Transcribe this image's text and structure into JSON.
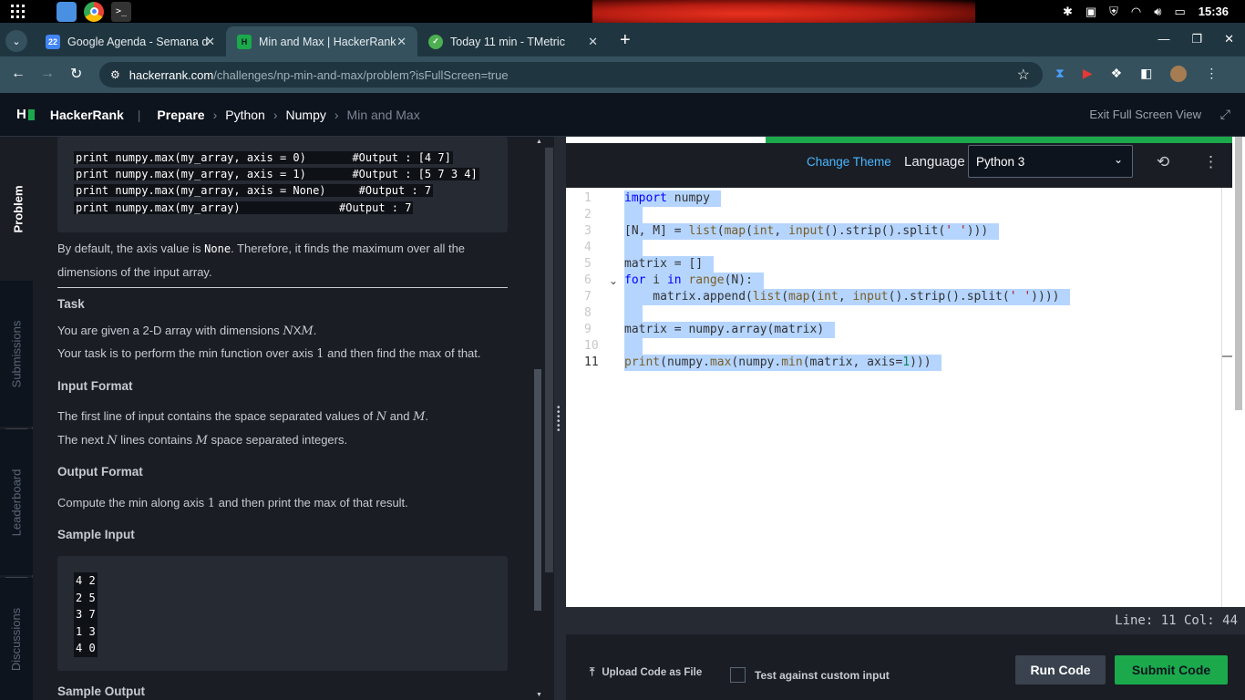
{
  "os": {
    "time": "15:36"
  },
  "browser": {
    "tabs": [
      {
        "title": "Google Agenda - Semana de",
        "icon": "calendar-icon",
        "color": "#4285f4"
      },
      {
        "title": "Min and Max | HackerRank",
        "icon": "hackerrank-icon",
        "color": "#1ba94c"
      },
      {
        "title": "Today 11 min - TMetric",
        "icon": "tmetric-icon",
        "color": "#4caf50"
      }
    ],
    "url_host": "hackerrank.com",
    "url_path": "/challenges/np-min-and-max/problem?isFullScreen=true"
  },
  "header": {
    "logo_text": "HackerRank",
    "breadcrumb": [
      "Prepare",
      "Python",
      "Numpy",
      "Min and Max"
    ],
    "exit_fullscreen": "Exit Full Screen View"
  },
  "sidebar": {
    "tabs": [
      "Problem",
      "Submissions",
      "Leaderboard",
      "Discussions"
    ]
  },
  "problem": {
    "code_lines": [
      {
        "code": "print numpy.max(my_array, axis = 0)",
        "comment": "#Output : [4 7]"
      },
      {
        "code": "print numpy.max(my_array, axis = 1)",
        "comment": "#Output : [5 7 3 4]"
      },
      {
        "code": "print numpy.max(my_array, axis = None)",
        "comment": "#Output : 7"
      },
      {
        "code": "print numpy.max(my_array)",
        "comment": "#Output : 7"
      }
    ],
    "default_pre": "By default, the axis value is ",
    "default_code": "None",
    "default_post": ". Therefore, it finds the maximum over all the dimensions of the input array.",
    "task_heading": "Task",
    "task_line1_pre": "You are given a 2-D array with dimensions ",
    "task_dims": "N",
    "task_x": "X",
    "task_dims2": "M",
    "task_line1_post": ".",
    "task_line2_pre": "Your task is to perform the min function over axis ",
    "task_axis": "1",
    "task_line2_post": " and then find the max of that.",
    "input_heading": "Input Format",
    "input_line1_pre": "The first line of input contains the space separated values of ",
    "input_N": "N",
    "input_and": " and ",
    "input_M": "M",
    "input_line1_post": ".",
    "input_line2_pre": "The next ",
    "input_line2_N": "N",
    "input_line2_mid": " lines contains ",
    "input_line2_M": "M",
    "input_line2_post": " space separated integers.",
    "output_heading": "Output Format",
    "output_pre": "Compute the min along axis ",
    "output_axis": "1",
    "output_post": " and then print the max of that result.",
    "sample_input_heading": "Sample Input",
    "sample_input": [
      "4 2",
      "2 5",
      "3 7",
      "1 3",
      "4 0"
    ],
    "sample_output_heading": "Sample Output"
  },
  "editor": {
    "change_theme": "Change Theme",
    "language_label": "Language",
    "language_value": "Python 3",
    "line_numbers": [
      "1",
      "2",
      "3",
      "4",
      "5",
      "6",
      "7",
      "8",
      "9",
      "10",
      "11"
    ],
    "status": "Line: 11 Col: 44",
    "upload": "Upload Code as File",
    "custom_input": "Test against custom input",
    "run": "Run Code",
    "submit": "Submit Code"
  }
}
